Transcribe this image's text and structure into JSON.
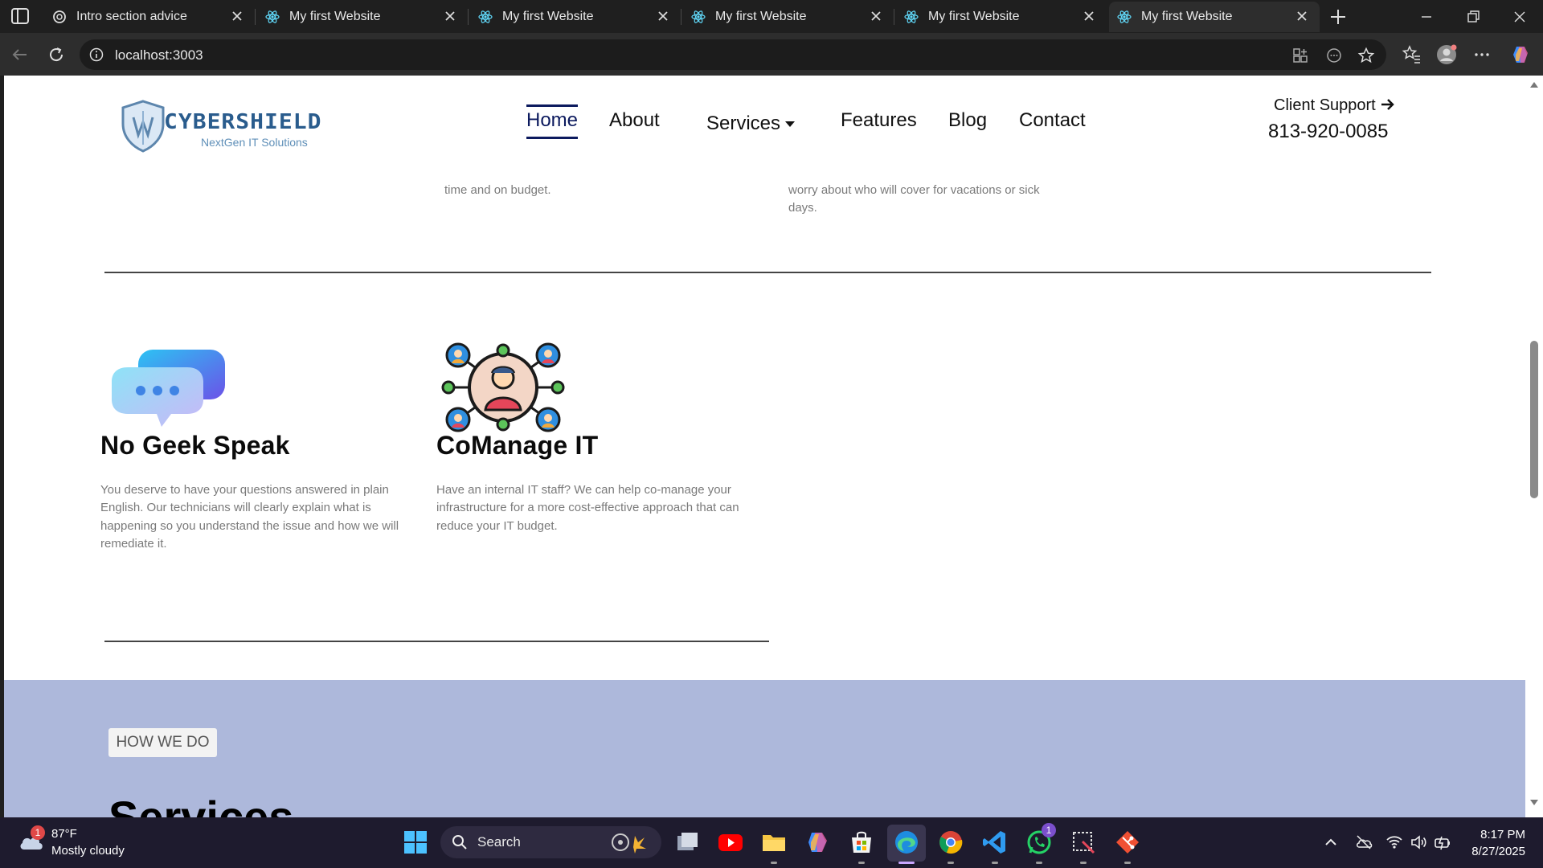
{
  "browser": {
    "tabs": [
      {
        "title": "Intro section advice",
        "icon": "chatgpt-icon",
        "active": false
      },
      {
        "title": "My first Website",
        "icon": "react-icon",
        "active": false
      },
      {
        "title": "My first Website",
        "icon": "react-icon",
        "active": false
      },
      {
        "title": "My first Website",
        "icon": "react-icon",
        "active": false
      },
      {
        "title": "My first Website",
        "icon": "react-icon",
        "active": false
      },
      {
        "title": "My first Website",
        "icon": "react-icon",
        "active": true
      }
    ],
    "url": "localhost:3003"
  },
  "site": {
    "logo_text": "CYBERSHIELD",
    "logo_tagline": "NextGen IT Solutions",
    "nav": {
      "home": "Home",
      "about": "About",
      "services": "Services",
      "features": "Features",
      "blog": "Blog",
      "contact": "Contact"
    },
    "support_label": "Client Support",
    "support_phone": "813-920-0085",
    "cut_para_left": "time and on budget.",
    "cut_para_right_line1": "worry about who will cover for vacations or sick",
    "cut_para_right_line2": "days.",
    "features": [
      {
        "title": "No Geek Speak",
        "icon": "chat-bubbles-icon",
        "lines": [
          "You deserve to have your questions answered in plain",
          "English. Our technicians will clearly explain what is",
          "happening so you understand the issue and how we will",
          "remediate it."
        ]
      },
      {
        "title": "CoManage IT",
        "icon": "team-network-icon",
        "lines": [
          "Have an internal IT staff? We can help co-manage your",
          "infrastructure for a more cost-effective approach that can",
          "reduce your IT budget."
        ]
      }
    ],
    "badge": "HOW WE DO",
    "services_title": "Services"
  },
  "taskbar": {
    "weather_temp": "87°F",
    "weather_cond": "Mostly cloudy",
    "weather_badge": "1",
    "search_label": "Search",
    "whatsapp_badge": "1",
    "time": "8:17 PM",
    "date": "8/27/2025"
  },
  "colors": {
    "nav_active": "#0c1a5e",
    "services_band": "#adb8db",
    "taskbar": "#1e1b2e"
  }
}
